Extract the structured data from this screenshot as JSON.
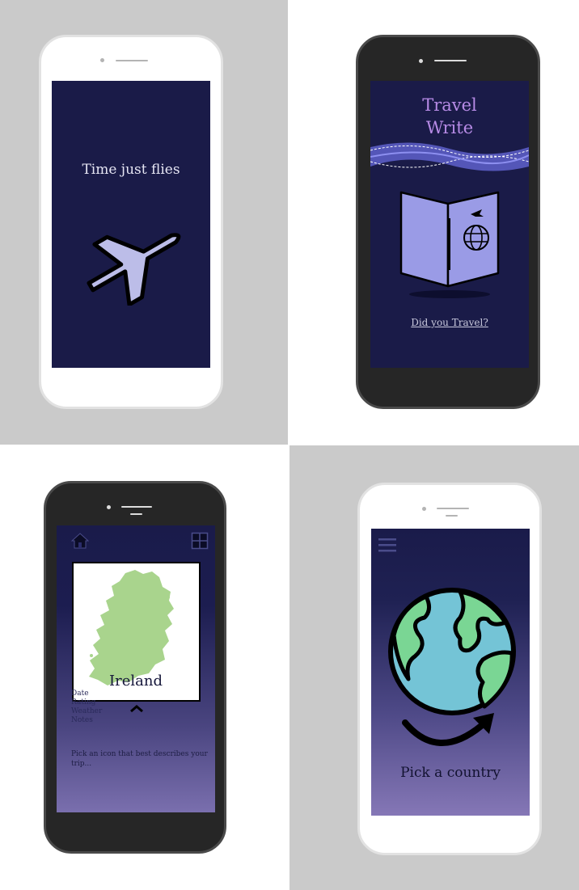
{
  "screens": {
    "splash": {
      "tagline": "Time just flies"
    },
    "welcome": {
      "title_line1": "Travel",
      "title_line2": "Write",
      "link": "Did you Travel?"
    },
    "country": {
      "country_name": "Ireland",
      "fields": [
        "Date",
        "Rating",
        "Weather",
        "Notes"
      ],
      "prompt": "Pick an icon that best describes your trip..."
    },
    "picker": {
      "cta": "Pick a country"
    }
  },
  "icons": {
    "plane": "airplane-icon",
    "passport": "passport-icon",
    "home": "home-icon",
    "grid": "grid-icon",
    "chevron": "chevron-up-icon",
    "menu": "hamburger-menu-icon",
    "globe": "globe-icon",
    "arrow": "curved-arrow-icon"
  },
  "colors": {
    "background_grey": "#cacaca",
    "screen_navy": "#1a1b48",
    "accent_purple": "#b78be6",
    "passport_lavender": "#9a9be6",
    "map_green": "#a9d48d",
    "globe_ocean": "#74c4d6",
    "globe_land": "#7ad694"
  }
}
